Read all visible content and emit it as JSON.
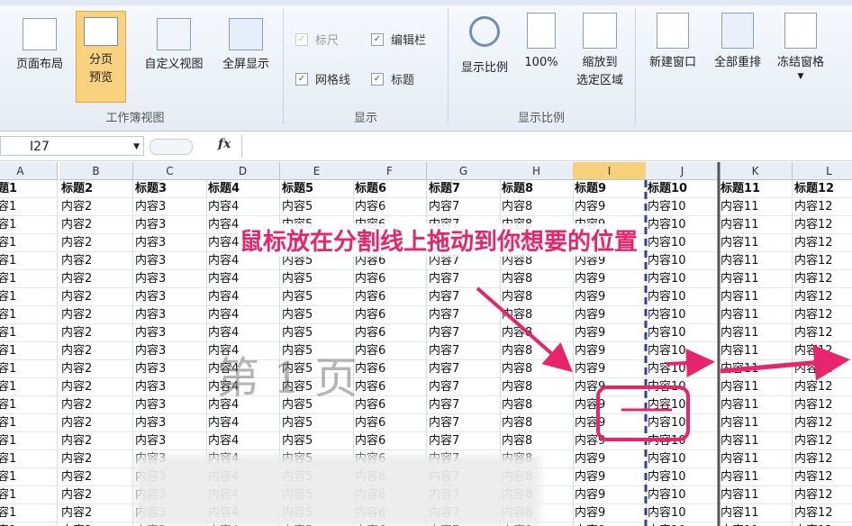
{
  "ribbon": {
    "buttons": {
      "page_layout": "页面布局",
      "page_break_preview_l1": "分页",
      "page_break_preview_l2": "预览",
      "custom_view": "自定义视图",
      "full_screen": "全屏显示",
      "zoom": "显示比例",
      "zoom_100": "100%",
      "zoom_sel_l1": "缩放到",
      "zoom_sel_l2": "选定区域",
      "new_window": "新建窗口",
      "arrange_all": "全部重排",
      "freeze_panes": "冻结窗格"
    },
    "checks": {
      "ruler": "标尺",
      "formula_bar": "编辑栏",
      "gridlines": "网格线",
      "headings": "标题"
    },
    "groups": {
      "workbook_views": "工作簿视图",
      "show": "显示",
      "zoom": "显示比例"
    }
  },
  "formula_bar": {
    "name_box": "I27",
    "fx": "fx"
  },
  "columns": [
    "A",
    "B",
    "C",
    "D",
    "E",
    "F",
    "G",
    "H",
    "I",
    "J",
    "K",
    "L"
  ],
  "selected_column": "I",
  "rows": {
    "headers": [
      "标题1",
      "标题2",
      "标题3",
      "标题4",
      "标题5",
      "标题6",
      "标题7",
      "标题8",
      "标题9",
      "标题10",
      "标题11",
      "标题12"
    ],
    "content": [
      "内容1",
      "内容2",
      "内容3",
      "内容4",
      "内容5",
      "内容6",
      "内容7",
      "内容8",
      "内容9",
      "内容10",
      "内容11",
      "内容12"
    ]
  },
  "overlay": {
    "annotation": "鼠标放在分割线上拖动到你想要的位置",
    "watermark": "第 1 页",
    "color": "#e8246a"
  }
}
